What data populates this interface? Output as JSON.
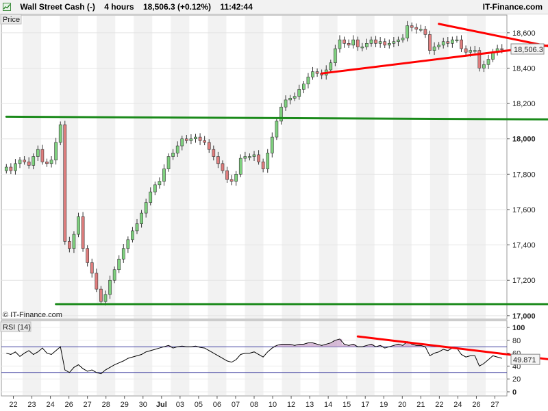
{
  "header": {
    "instrument": "Wall Street Cash (-)",
    "timeframe": "4 hours",
    "price_change": "18,506.3 (+0.12%)",
    "time": "11:42:44",
    "brand": "IT-Finance.com"
  },
  "price_panel": {
    "label": "Price",
    "watermark": "© IT-Finance.com",
    "current_price_label": "18,506.3"
  },
  "rsi_panel": {
    "label": "RSI (14)",
    "current_value_label": "49.871"
  },
  "colors": {
    "up_candle": "#7fd17f",
    "down_candle": "#e07e7e",
    "green_line": "#1a8a1a",
    "red_line": "#ff0000",
    "rsi_line": "#000000",
    "rsi_band": "#4040a0",
    "rsi_fill": "#c8a0c8"
  },
  "chart_data": [
    {
      "type": "candlestick",
      "x_tick_labels": [
        "22",
        "23",
        "24",
        "26",
        "27",
        "28",
        "29",
        "30",
        "Jul",
        "03",
        "05",
        "06",
        "07",
        "08",
        "10",
        "12",
        "13",
        "14",
        "15",
        "17",
        "19",
        "20",
        "21",
        "22",
        "24",
        "26",
        "27"
      ],
      "y_ticks": [
        17000,
        17200,
        17400,
        17600,
        17800,
        18000,
        18200,
        18400,
        18600
      ],
      "y_tick_labels": [
        "17,000",
        "17,200",
        "17,400",
        "17,600",
        "17,800",
        "18,000",
        "18,200",
        "18,400",
        "18,600"
      ],
      "ylim": [
        16980,
        18700
      ],
      "current_price": 18506.3,
      "close_series": [
        17840,
        17820,
        17860,
        17880,
        17870,
        17850,
        17900,
        17940,
        17870,
        17860,
        17880,
        17980,
        18080,
        17420,
        17380,
        17460,
        17560,
        17380,
        17300,
        17240,
        17150,
        17080,
        17120,
        17200,
        17260,
        17320,
        17380,
        17430,
        17480,
        17520,
        17580,
        17640,
        17700,
        17740,
        17760,
        17830,
        17900,
        17920,
        17960,
        18000,
        17990,
        18000,
        18010,
        17990,
        17980,
        17940,
        17900,
        17860,
        17820,
        17770,
        17760,
        17800,
        17890,
        17900,
        17900,
        17910,
        17870,
        17830,
        17920,
        18010,
        18100,
        18180,
        18220,
        18230,
        18240,
        18280,
        18310,
        18350,
        18380,
        18370,
        18360,
        18390,
        18430,
        18510,
        18560,
        18540,
        18530,
        18560,
        18520,
        18520,
        18540,
        18560,
        18540,
        18550,
        18530,
        18540,
        18550,
        18560,
        18570,
        18640,
        18630,
        18620,
        18620,
        18590,
        18500,
        18520,
        18530,
        18550,
        18540,
        18560,
        18560,
        18510,
        18490,
        18500,
        18500,
        18400,
        18420,
        18450,
        18490,
        18510,
        18506
      ],
      "trendlines": [
        {
          "color": "green",
          "points": [
            [
              0,
              18125
            ],
            [
              121,
              18110
            ]
          ]
        },
        {
          "color": "green",
          "points": [
            [
              11,
              17065
            ],
            [
              121,
              17065
            ]
          ]
        },
        {
          "color": "red",
          "points": [
            [
              70,
              18370
            ],
            [
              121,
              18530
            ]
          ]
        },
        {
          "color": "red",
          "points": [
            [
              96,
              18650
            ],
            [
              121,
              18520
            ]
          ]
        }
      ]
    },
    {
      "type": "line",
      "name": "RSI (14)",
      "y_ticks": [
        0,
        20,
        40,
        60,
        80,
        100
      ],
      "ylim": [
        0,
        100
      ],
      "bands": [
        30,
        70
      ],
      "current_value": 49.871,
      "values": [
        60,
        58,
        62,
        55,
        60,
        64,
        58,
        62,
        68,
        60,
        58,
        64,
        70,
        34,
        30,
        38,
        42,
        36,
        32,
        34,
        30,
        28,
        34,
        38,
        42,
        45,
        48,
        52,
        54,
        56,
        58,
        62,
        64,
        66,
        68,
        70,
        72,
        68,
        70,
        71,
        70,
        70,
        71,
        69,
        68,
        64,
        60,
        56,
        52,
        48,
        46,
        50,
        58,
        60,
        60,
        62,
        58,
        54,
        62,
        68,
        72,
        74,
        74,
        74,
        72,
        74,
        74,
        76,
        76,
        74,
        72,
        74,
        76,
        80,
        82,
        74,
        72,
        74,
        70,
        70,
        72,
        74,
        70,
        72,
        68,
        70,
        72,
        74,
        72,
        78,
        74,
        72,
        72,
        70,
        56,
        60,
        62,
        66,
        64,
        68,
        68,
        58,
        54,
        56,
        56,
        40,
        44,
        50,
        56,
        54,
        52
      ],
      "trendlines": [
        {
          "color": "red",
          "points": [
            [
              78,
              86
            ],
            [
              121,
              50
            ]
          ]
        }
      ]
    }
  ]
}
